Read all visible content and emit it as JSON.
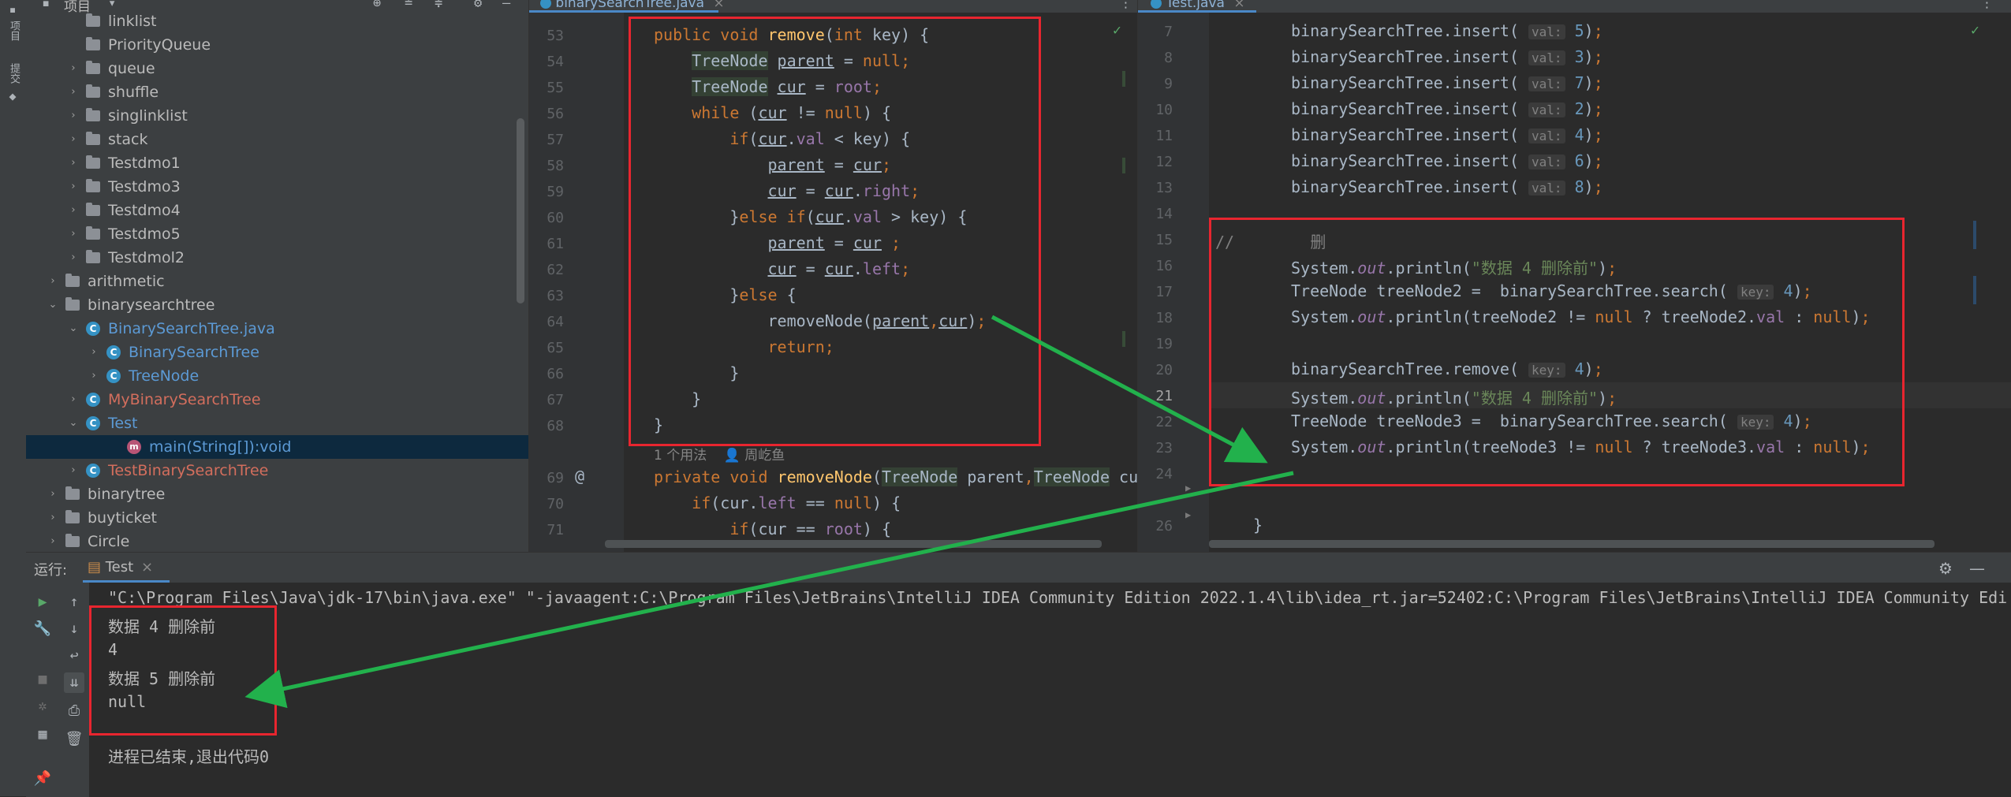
{
  "left_strip": {
    "labels": [
      "项目",
      "提交"
    ]
  },
  "project": {
    "title": "项目",
    "rows": [
      {
        "label": "linklist",
        "kind": "folder",
        "indent": 2,
        "arrow": ""
      },
      {
        "label": "PriorityQueue",
        "kind": "folder",
        "indent": 2,
        "arrow": ""
      },
      {
        "label": "queue",
        "kind": "folder",
        "indent": 2,
        "arrow": "right"
      },
      {
        "label": "shuffle",
        "kind": "folder",
        "indent": 2,
        "arrow": "right"
      },
      {
        "label": "singlinklist",
        "kind": "folder",
        "indent": 2,
        "arrow": "right"
      },
      {
        "label": "stack",
        "kind": "folder",
        "indent": 2,
        "arrow": "right"
      },
      {
        "label": "Testdmo1",
        "kind": "folder",
        "indent": 2,
        "arrow": "right"
      },
      {
        "label": "Testdmo3",
        "kind": "folder",
        "indent": 2,
        "arrow": "right"
      },
      {
        "label": "Testdmo4",
        "kind": "folder",
        "indent": 2,
        "arrow": "right"
      },
      {
        "label": "Testdmo5",
        "kind": "folder",
        "indent": 2,
        "arrow": "right"
      },
      {
        "label": "Testdmol2",
        "kind": "folder",
        "indent": 2,
        "arrow": "right"
      },
      {
        "label": "arithmetic",
        "kind": "folder",
        "indent": 1,
        "arrow": "right"
      },
      {
        "label": "binarysearchtree",
        "kind": "folder",
        "indent": 1,
        "arrow": "down"
      },
      {
        "label": "BinarySearchTree.java",
        "kind": "jfile",
        "indent": 2,
        "arrow": "down",
        "color": "blue"
      },
      {
        "label": "BinarySearchTree",
        "kind": "cls",
        "indent": 3,
        "arrow": "right",
        "color": "blue"
      },
      {
        "label": "TreeNode",
        "kind": "cls",
        "indent": 3,
        "arrow": "right",
        "color": "blue"
      },
      {
        "label": "MyBinarySearchTree",
        "kind": "cls",
        "indent": 2,
        "arrow": "right",
        "color": "red"
      },
      {
        "label": "Test",
        "kind": "cls",
        "indent": 2,
        "arrow": "down",
        "color": "blue"
      },
      {
        "label": "main(String[]):void",
        "kind": "mth",
        "indent": 4,
        "arrow": "",
        "color": "blue",
        "selected": true
      },
      {
        "label": "TestBinarySearchTree",
        "kind": "cls",
        "indent": 2,
        "arrow": "right",
        "color": "red"
      },
      {
        "label": "binarytree",
        "kind": "folder",
        "indent": 1,
        "arrow": "right"
      },
      {
        "label": "buyticket",
        "kind": "folder",
        "indent": 1,
        "arrow": "right"
      },
      {
        "label": "Circle",
        "kind": "folder",
        "indent": 1,
        "arrow": "right"
      }
    ]
  },
  "editor1": {
    "tab": "binarySearchTree.java",
    "usage_hint": "1 个用法",
    "usage_author": "周屹鱼"
  },
  "editor2": {
    "tab": "Test.java"
  },
  "run": {
    "label": "运行:",
    "tab": "Test",
    "cmd": "\"C:\\Program Files\\Java\\jdk-17\\bin\\java.exe\" \"-javaagent:C:\\Program Files\\JetBrains\\IntelliJ IDEA Community Edition 2022.1.4\\lib\\idea_rt.jar=52402:C:\\Program Files\\JetBrains\\IntelliJ IDEA Community Edi",
    "output": [
      "数据 4 删除前",
      "4",
      "数据 5 删除前",
      "null",
      "",
      "进程已结束,退出代码0"
    ]
  },
  "colors": {
    "highlight_box": "#e8252f",
    "arrow": "#22b14c",
    "selection": "#0d293e"
  }
}
